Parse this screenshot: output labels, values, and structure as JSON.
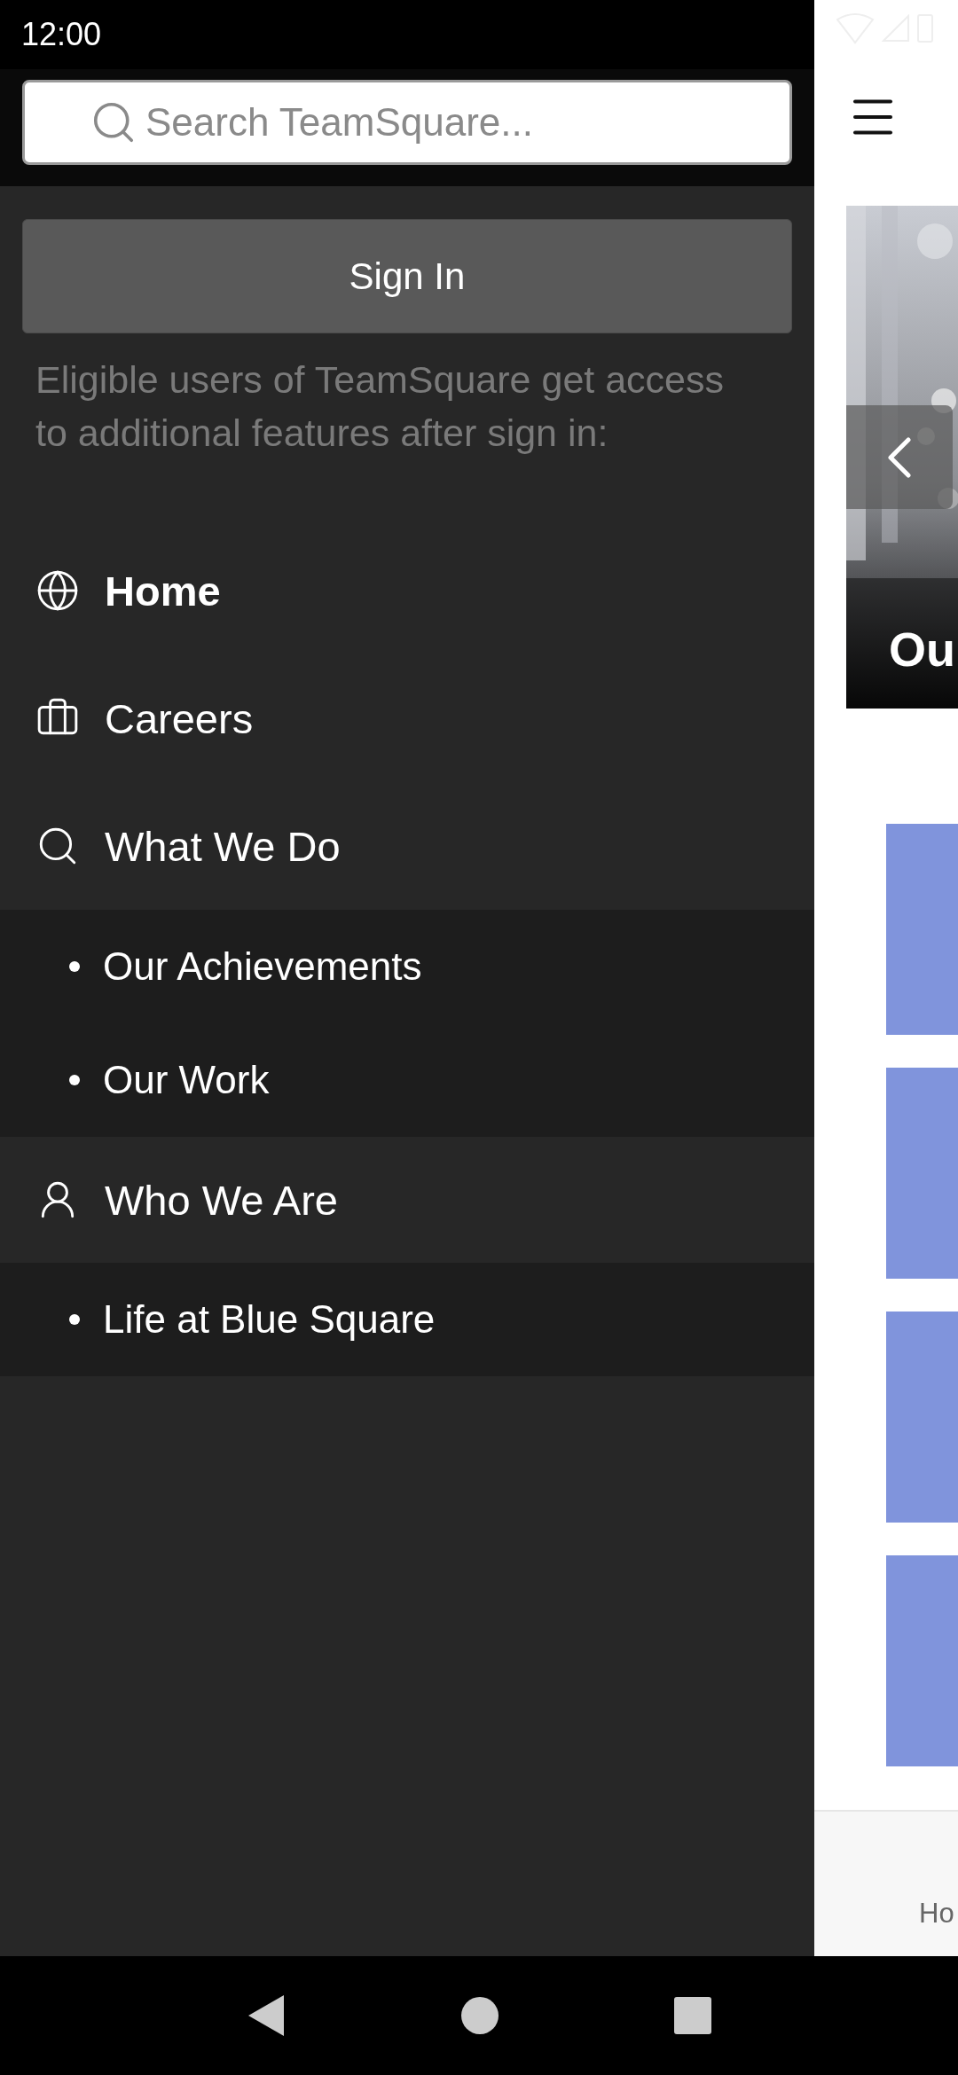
{
  "status_bar": {
    "time": "12:00"
  },
  "drawer": {
    "search": {
      "placeholder": "Search TeamSquare..."
    },
    "sign_in_button": "Sign In",
    "note": "Eligible users of TeamSquare get access to additional features after sign in:",
    "menu": [
      {
        "label": "Home",
        "selected": true
      },
      {
        "label": "Careers",
        "selected": false
      },
      {
        "label": "What We Do",
        "selected": false,
        "children": [
          {
            "label": "Our Achievements",
            "selected": false
          },
          {
            "label": "Our Work",
            "selected": false
          }
        ]
      },
      {
        "label": "Who We Are",
        "selected": false,
        "children": [
          {
            "label": "Life at Blue Square",
            "selected": false
          }
        ]
      }
    ]
  },
  "page": {
    "hero": {
      "kind": "picture",
      "title": "Ou"
    },
    "bottom_nav": {
      "label": "Ho"
    }
  }
}
